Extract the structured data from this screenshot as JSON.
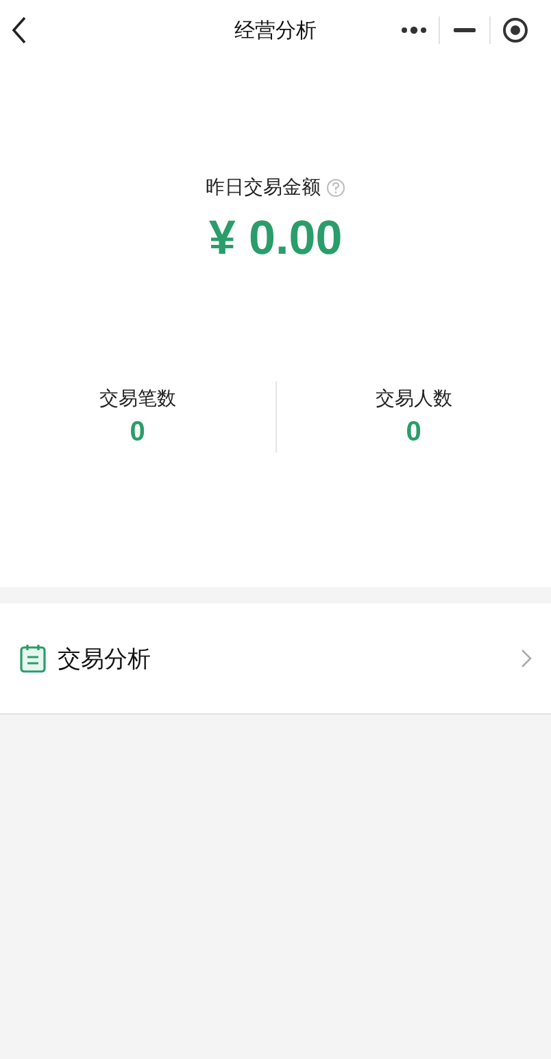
{
  "nav": {
    "title": "经营分析"
  },
  "summary": {
    "label": "昨日交易金额",
    "amount": "¥ 0.00"
  },
  "stats": [
    {
      "label": "交易笔数",
      "value": "0"
    },
    {
      "label": "交易人数",
      "value": "0"
    }
  ],
  "menu": [
    {
      "label": "交易分析"
    }
  ]
}
